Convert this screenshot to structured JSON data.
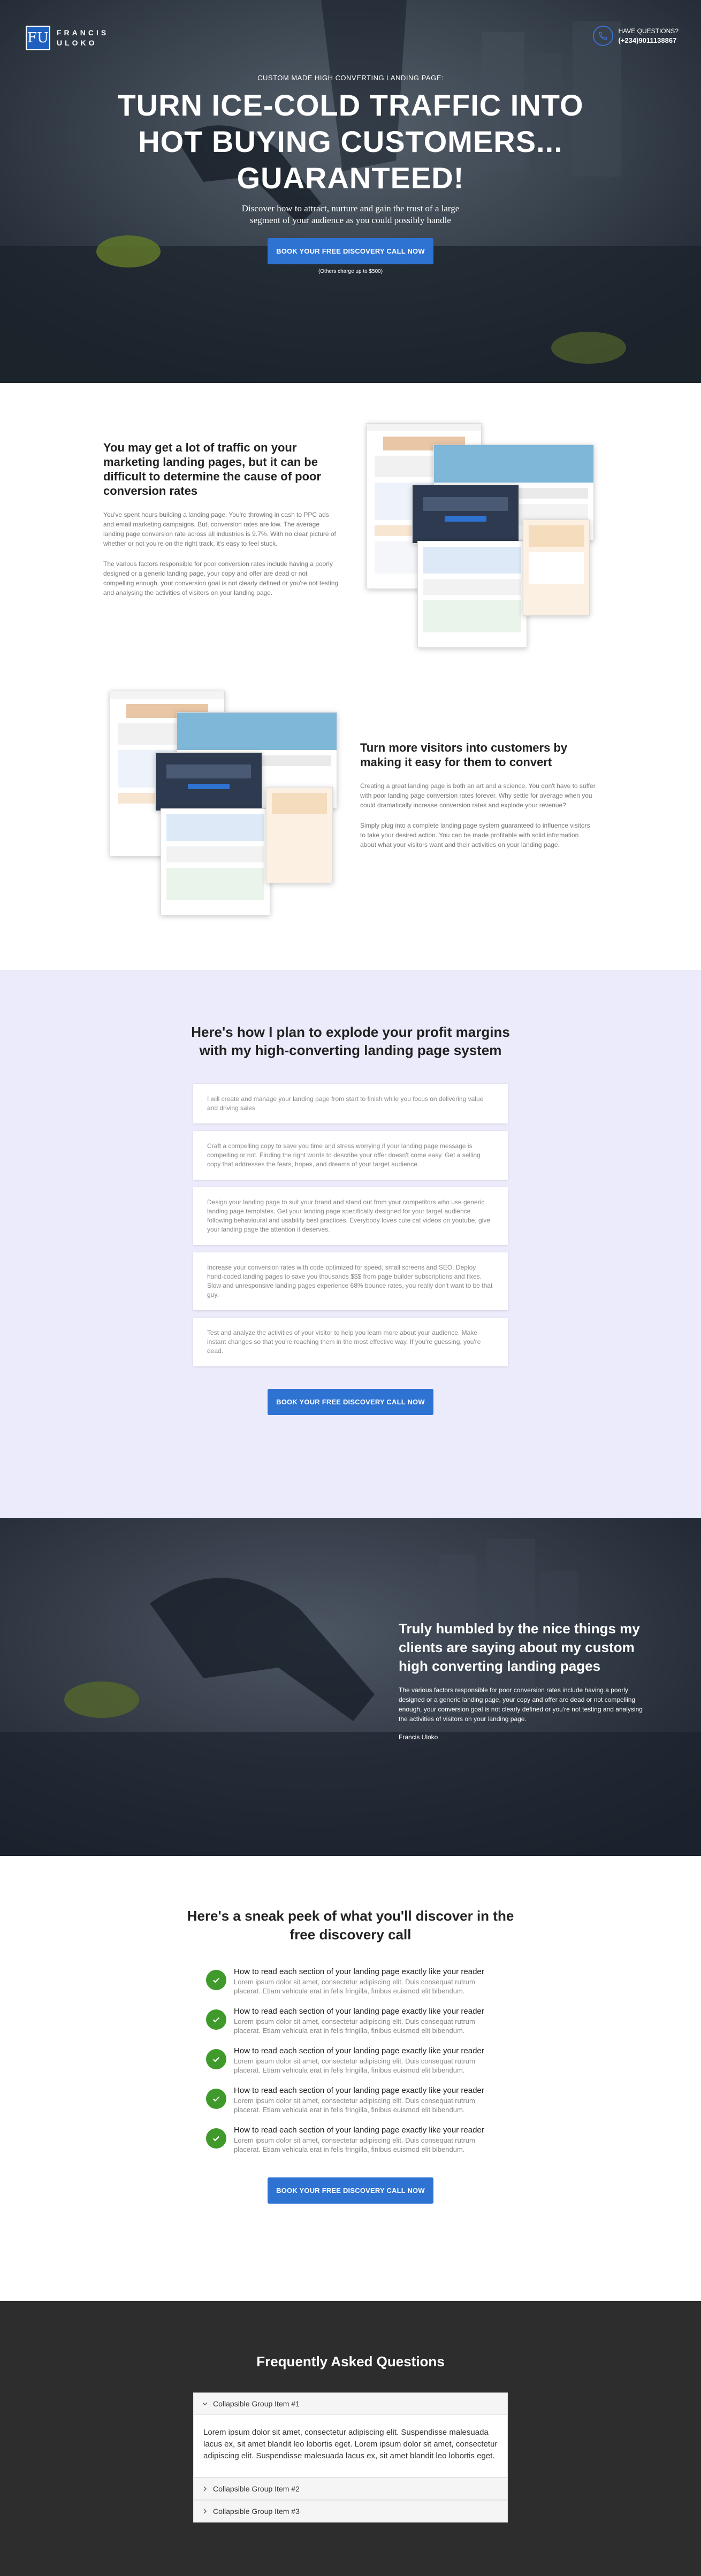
{
  "header": {
    "logo_mark": "FU",
    "logo_line1": "FRANCIS",
    "logo_line2": "ULOKO",
    "contact_label": "HAVE QUESTIONS?",
    "contact_phone": "(+234)9011138867"
  },
  "hero": {
    "kicker": "CUSTOM MADE HIGH CONVERTING LANDING PAGE:",
    "title": "Turn Ice-Cold Traffic Into Hot Buying Customers... Guaranteed!",
    "subtitle": "Discover how to attract, nurture and gain the trust of a large segment of your audience as you could possibly handle",
    "cta": "BOOK YOUR FREE DISCOVERY CALL NOW",
    "note": "(Others charge up to $500)"
  },
  "feature1": {
    "title": "You may get a lot of traffic on your marketing landing pages, but it can be difficult to determine the cause of poor conversion rates",
    "p1": "You've spent hours building a landing page. You're throwing in cash to PPC ads and email marketing campaigns. But, conversion rates are low. The average landing page conversion rate across all industries is 9.7%. With no clear picture of whether or not you're on the right track, it's easy to feel stuck.",
    "p2": "The various factors responsible for poor conversion rates include having a poorly designed or a generic landing page, your copy and offer are dead or not compelling enough, your conversion goal is not clearly defined or you're not testing and analysing the activities of visitors on your landing page."
  },
  "feature2": {
    "title": "Turn more visitors into customers by making it easy for them to convert",
    "p1": "Creating a great landing page is both an art and a science. You don't have to suffer with poor landing page conversion rates forever. Why settle for average when you could dramatically increase conversion rates and explode your revenue?",
    "p2": "Simply plug into a complete landing page system guaranteed to influence visitors to take your desired action. You can be made profitable with solid information about what your visitors want and their activities on your landing page."
  },
  "plan": {
    "title": "Here's how I plan to explode your profit margins with my high-converting landing page system",
    "cards": [
      "I will create and manage your landing page from start to finish while you focus on delivering value and driving sales",
      "Craft a compelling copy to save you time and stress worrying if your landing page message is compelling or not. Finding the right words to describe your offer doesn't come easy. Get a selling copy that addresses the fears, hopes, and dreams of your target audience.",
      "Design your landing page to suit your brand and stand out from your competitors who use generic landing page templates. Get your landing page specifically designed for your target audience following behavioural and usability best practices. Everybody loves cute cat videos on youtube, give your landing page the attention it deserves.",
      "Increase your conversion rates with code optimized for speed, small screens and SEO. Deploy hand-coded landing pages to save you thousands $$$ from page builder subscriptions and fixes. Slow and unresponsive landing pages experience 68% bounce rates, you really don't want to be that guy.",
      "Test and analyze the activities of your visitor to help you learn more about your audience. Make instant changes so that you're reaching them in the most effective way. If you're guessing, you're dead."
    ],
    "cta": "BOOK YOUR FREE DISCOVERY CALL NOW"
  },
  "testimonial": {
    "title": "Truly humbled by the nice things my clients are saying about my custom high converting landing pages",
    "quote": "The various factors responsible for poor conversion rates include having a poorly designed or a generic landing page, your copy and offer are dead or not compelling enough, your conversion goal is not clearly defined or you're not testing and analysing the activities of visitors on your landing page.",
    "author": "Francis Uloko"
  },
  "sneak": {
    "title": "Here's a sneak peek of what you'll discover in the free discovery call",
    "items": [
      {
        "title": "How to read each section of your landing page exactly like your reader",
        "desc": "Lorem ipsum dolor sit amet, consectetur adipiscing elit. Duis consequat rutrum placerat. Etiam vehicula erat in felis fringilla, finibus euismod elit bibendum."
      },
      {
        "title": "How to read each section of your landing page exactly like your reader",
        "desc": "Lorem ipsum dolor sit amet, consectetur adipiscing elit. Duis consequat rutrum placerat. Etiam vehicula erat in felis fringilla, finibus euismod elit bibendum."
      },
      {
        "title": "How to read each section of your landing page exactly like your reader",
        "desc": "Lorem ipsum dolor sit amet, consectetur adipiscing elit. Duis consequat rutrum placerat. Etiam vehicula erat in felis fringilla, finibus euismod elit bibendum."
      },
      {
        "title": "How to read each section of your landing page exactly like your reader",
        "desc": "Lorem ipsum dolor sit amet, consectetur adipiscing elit. Duis consequat rutrum placerat. Etiam vehicula erat in felis fringilla, finibus euismod elit bibendum."
      },
      {
        "title": "How to read each section of your landing page exactly like your reader",
        "desc": "Lorem ipsum dolor sit amet, consectetur adipiscing elit. Duis consequat rutrum placerat. Etiam vehicula erat in felis fringilla, finibus euismod elit bibendum."
      }
    ],
    "cta": "BOOK YOUR FREE DISCOVERY CALL NOW"
  },
  "faq": {
    "title": "Frequently Asked Questions",
    "items": [
      {
        "label": "Collapsible Group Item #1",
        "body": "Lorem ipsum dolor sit amet, consectetur adipiscing elit. Suspendisse malesuada lacus ex, sit amet blandit leo lobortis eget. Lorem ipsum dolor sit amet, consectetur adipiscing elit. Suspendisse malesuada lacus ex, sit amet blandit leo lobortis eget."
      },
      {
        "label": "Collapsible Group Item #2"
      },
      {
        "label": "Collapsible Group Item #3"
      }
    ]
  },
  "colors": {
    "accent": "#2e72d2",
    "check": "#3f9a2b",
    "plan_bg": "#ecebfb",
    "faq_bg": "#2d2d2d"
  }
}
